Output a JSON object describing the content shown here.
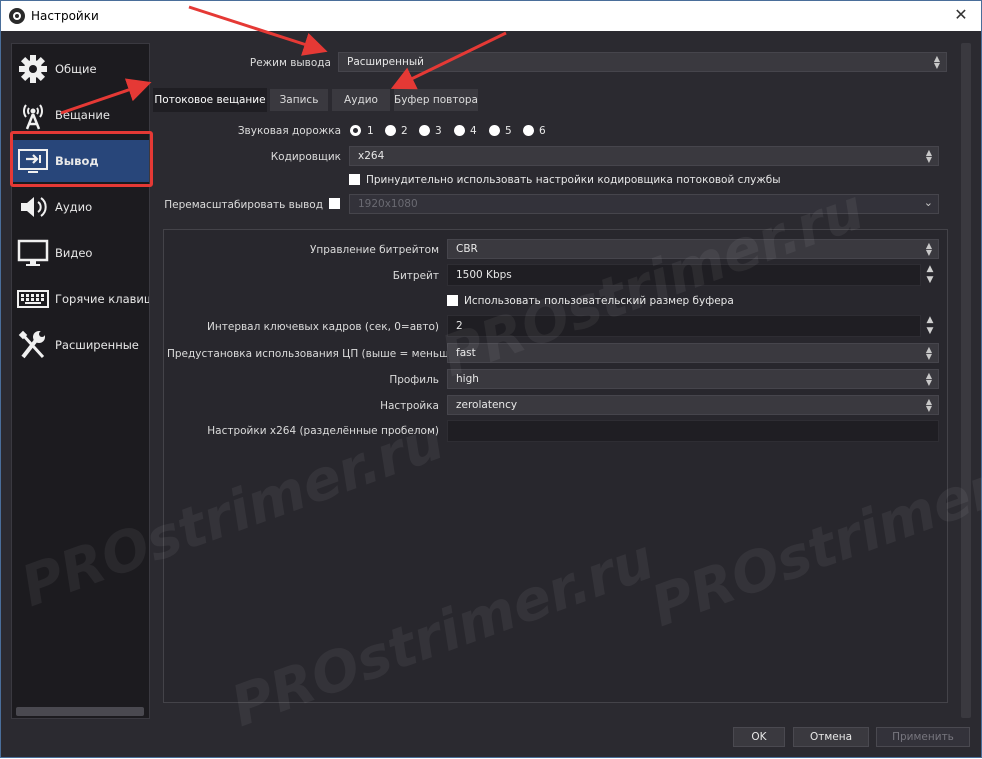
{
  "window": {
    "title": "Настройки",
    "close_glyph": "✕"
  },
  "sidebar": {
    "items": [
      {
        "label": "Общие",
        "icon": "gear-icon"
      },
      {
        "label": "Вещание",
        "icon": "broadcast-icon"
      },
      {
        "label": "Вывод",
        "icon": "output-icon",
        "active": true
      },
      {
        "label": "Аудио",
        "icon": "speaker-icon"
      },
      {
        "label": "Видео",
        "icon": "monitor-icon"
      },
      {
        "label": "Горячие клавиши",
        "icon": "keyboard-icon"
      },
      {
        "label": "Расширенные",
        "icon": "tools-icon"
      }
    ]
  },
  "output_mode": {
    "label": "Режим вывода",
    "value": "Расширенный"
  },
  "tabs": [
    {
      "label": "Потоковое вещание",
      "active": true
    },
    {
      "label": "Запись"
    },
    {
      "label": "Аудио"
    },
    {
      "label": "Буфер повтора"
    }
  ],
  "streaming": {
    "audio_track": {
      "label": "Звуковая дорожка",
      "options": [
        "1",
        "2",
        "3",
        "4",
        "5",
        "6"
      ],
      "selected": "1"
    },
    "encoder": {
      "label": "Кодировщик",
      "value": "x264"
    },
    "enforce_label": "Принудительно использовать настройки кодировщика потоковой службы",
    "rescale": {
      "label": "Перемасштабировать вывод",
      "value": "1920x1080"
    }
  },
  "encoder_settings": {
    "rate_control": {
      "label": "Управление битрейтом",
      "value": "CBR"
    },
    "bitrate": {
      "label": "Битрейт",
      "value": "1500 Kbps"
    },
    "custom_buffer_label": "Использовать пользовательский размер буфера",
    "keyframe": {
      "label": "Интервал ключевых кадров (сек, 0=авто)",
      "value": "2"
    },
    "cpu_preset": {
      "label": "Предустановка использования ЦП (выше = меньше)",
      "value": "fast"
    },
    "profile": {
      "label": "Профиль",
      "value": "high"
    },
    "tune": {
      "label": "Настройка",
      "value": "zerolatency"
    },
    "x264_options": {
      "label": "Настройки x264 (разделённые пробелом)",
      "value": ""
    }
  },
  "buttons": {
    "ok": "OK",
    "cancel": "Отмена",
    "apply": "Применить"
  },
  "watermark_text": "PROstrimer.ru",
  "colors": {
    "accent_active": "#28467a",
    "highlight_red": "#e53935",
    "background": "#2b2a30"
  }
}
